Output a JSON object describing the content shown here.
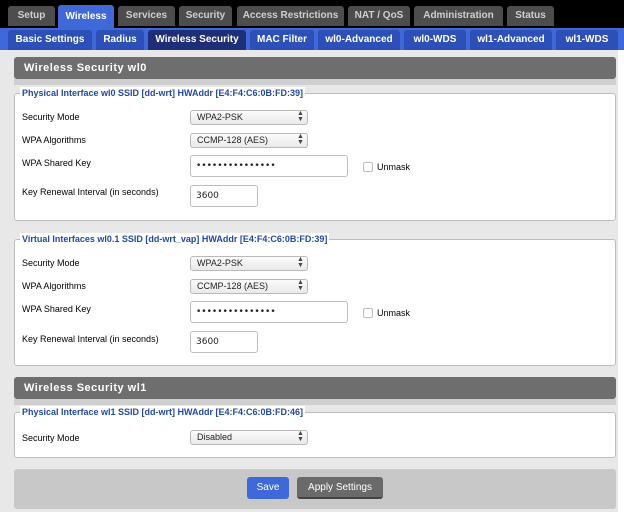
{
  "top_tabs": [
    "Setup",
    "Wireless",
    "Services",
    "Security",
    "Access Restrictions",
    "NAT / QoS",
    "Administration",
    "Status"
  ],
  "sub_tabs": [
    "Basic Settings",
    "Radius",
    "Wireless Security",
    "MAC Filter",
    "wl0-Advanced",
    "wl0-WDS",
    "wl1-Advanced",
    "wl1-WDS"
  ],
  "section_wl0": {
    "title": "Wireless Security wl0"
  },
  "wl0_physical": {
    "legend": "Physical Interface wl0 SSID [dd-wrt] HWAddr [E4:F4:C6:0B:FD:39]",
    "security_mode_label": "Security Mode",
    "security_mode_value": "WPA2-PSK",
    "wpa_algorithms_label": "WPA Algorithms",
    "wpa_algorithms_value": "CCMP-128 (AES)",
    "shared_key_label": "WPA Shared Key",
    "shared_key_value": "•••••••••••••••",
    "unmask_label": "Unmask",
    "renewal_label": "Key Renewal Interval (in seconds)",
    "renewal_value": "3600"
  },
  "wl0_virtual": {
    "legend": "Virtual Interfaces wl0.1 SSID [dd-wrt_vap] HWAddr [E4:F4:C6:0B:FD:39]",
    "security_mode_label": "Security Mode",
    "security_mode_value": "WPA2-PSK",
    "wpa_algorithms_label": "WPA Algorithms",
    "wpa_algorithms_value": "CCMP-128 (AES)",
    "shared_key_label": "WPA Shared Key",
    "shared_key_value": "•••••••••••••••",
    "unmask_label": "Unmask",
    "renewal_label": "Key Renewal Interval (in seconds)",
    "renewal_value": "3600"
  },
  "section_wl1": {
    "title": "Wireless Security wl1"
  },
  "wl1_physical": {
    "legend": "Physical Interface wl1 SSID [dd-wrt] HWAddr [E4:F4:C6:0B:FD:46]",
    "security_mode_label": "Security Mode",
    "security_mode_value": "Disabled"
  },
  "buttons": {
    "save": "Save",
    "apply": "Apply Settings"
  },
  "colors": {
    "accent": "#3f68d8",
    "tab_inactive": "#4d4d4d",
    "section_header": "#6e6e6e",
    "legend_text": "#2248a8"
  }
}
